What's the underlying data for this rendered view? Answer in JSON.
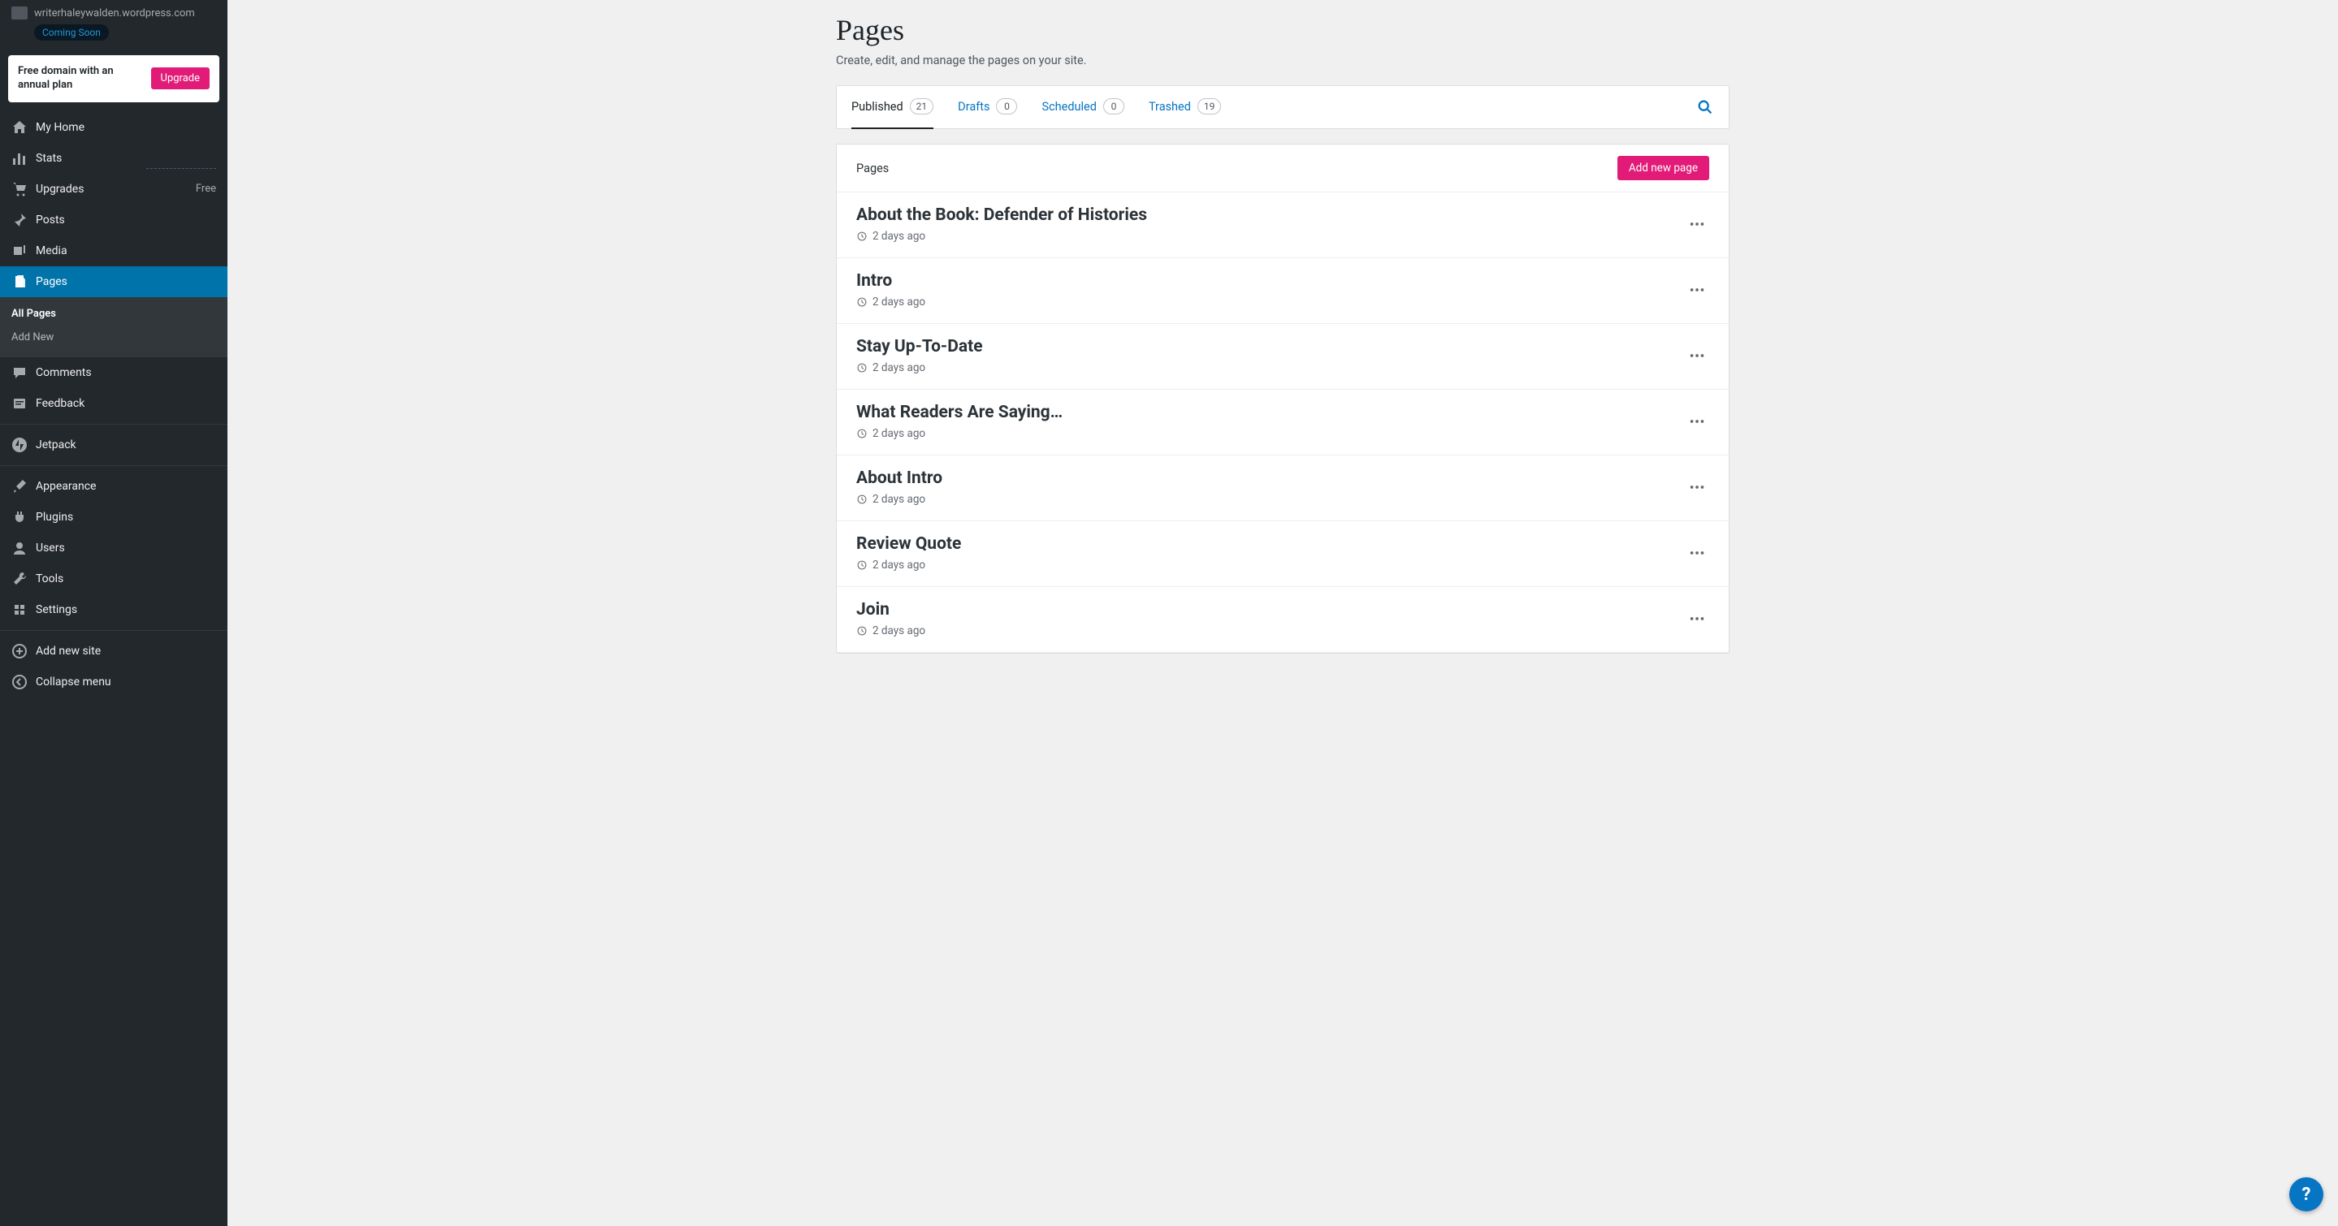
{
  "site": {
    "url": "writerhaleywalden.wordpress.com",
    "status_badge": "Coming Soon"
  },
  "promo": {
    "text": "Free domain with an annual plan",
    "button": "Upgrade"
  },
  "sidebar": {
    "items": [
      {
        "label": "My Home",
        "icon": "home-icon"
      },
      {
        "label": "Stats",
        "icon": "stats-icon"
      },
      {
        "label": "Upgrades",
        "icon": "cart-icon",
        "tag": "Free"
      },
      {
        "label": "Posts",
        "icon": "pin-icon"
      },
      {
        "label": "Media",
        "icon": "media-icon"
      },
      {
        "label": "Pages",
        "icon": "pages-icon"
      },
      {
        "label": "Comments",
        "icon": "comment-icon"
      },
      {
        "label": "Feedback",
        "icon": "feedback-icon"
      },
      {
        "label": "Jetpack",
        "icon": "jetpack-icon"
      },
      {
        "label": "Appearance",
        "icon": "brush-icon"
      },
      {
        "label": "Plugins",
        "icon": "plug-icon"
      },
      {
        "label": "Users",
        "icon": "user-icon"
      },
      {
        "label": "Tools",
        "icon": "tools-icon"
      },
      {
        "label": "Settings",
        "icon": "settings-icon"
      },
      {
        "label": "Add new site",
        "icon": "plus-circle-icon"
      },
      {
        "label": "Collapse menu",
        "icon": "collapse-icon"
      }
    ],
    "submenu": {
      "all_pages": "All Pages",
      "add_new": "Add New"
    }
  },
  "header": {
    "title": "Pages",
    "subtitle": "Create, edit, and manage the pages on your site."
  },
  "tabs": [
    {
      "label": "Published",
      "count": "21"
    },
    {
      "label": "Drafts",
      "count": "0"
    },
    {
      "label": "Scheduled",
      "count": "0"
    },
    {
      "label": "Trashed",
      "count": "19"
    }
  ],
  "list": {
    "header": "Pages",
    "add_button": "Add new page",
    "rows": [
      {
        "title": "About the Book: Defender of Histories",
        "meta": "2 days ago"
      },
      {
        "title": "Intro",
        "meta": "2 days ago"
      },
      {
        "title": "Stay Up-To-Date",
        "meta": "2 days ago"
      },
      {
        "title": "What Readers Are Saying…",
        "meta": "2 days ago"
      },
      {
        "title": "About Intro",
        "meta": "2 days ago"
      },
      {
        "title": "Review Quote",
        "meta": "2 days ago"
      },
      {
        "title": "Join",
        "meta": "2 days ago"
      }
    ]
  },
  "help": "?"
}
